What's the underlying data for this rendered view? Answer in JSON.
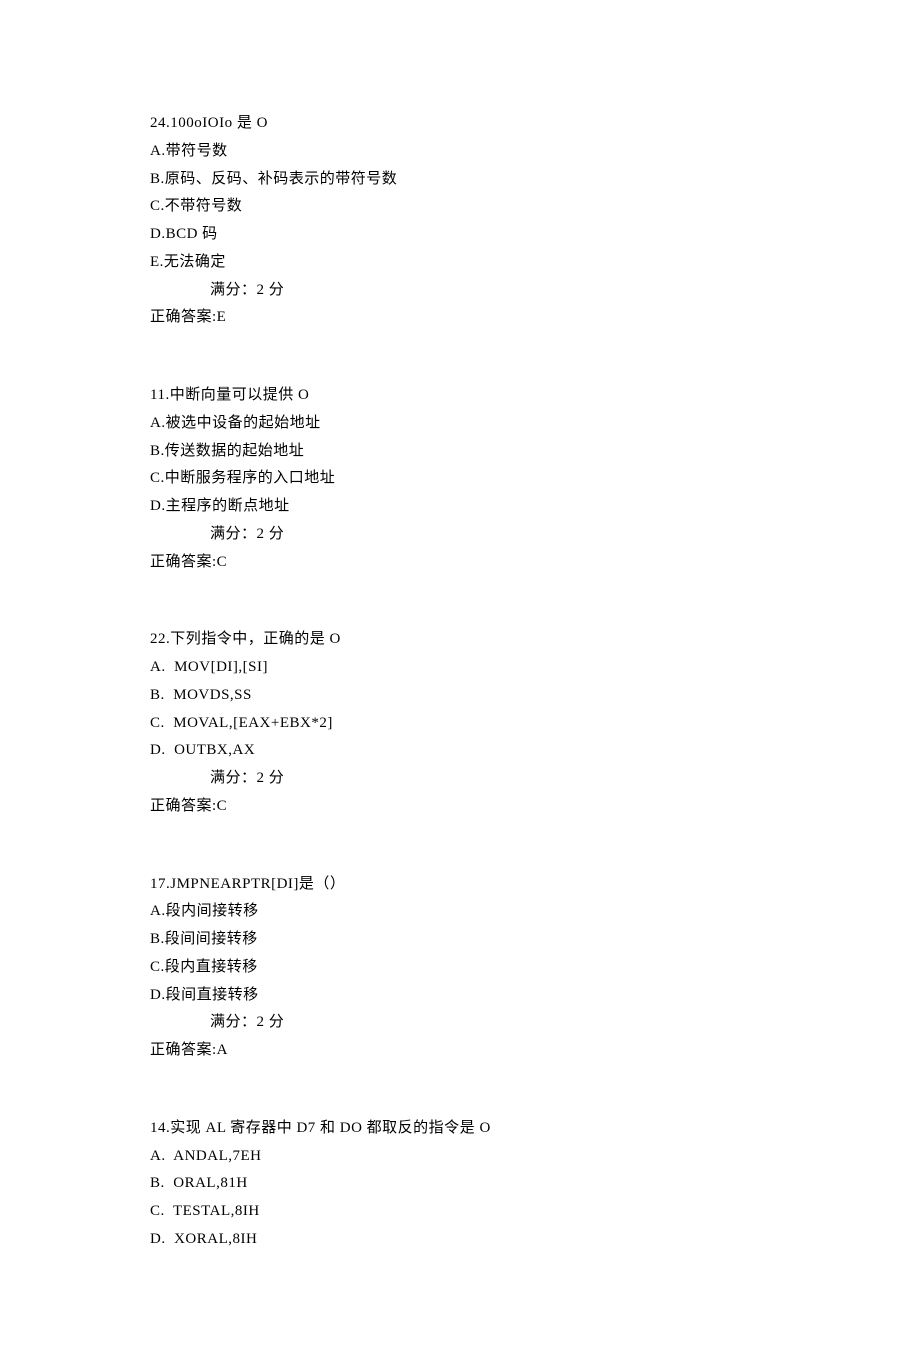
{
  "questions": [
    {
      "stem": "24.100oIOIo 是 O",
      "options": [
        "A.带符号数",
        "B.原码、反码、补码表示的带符号数",
        "C.不带符号数",
        "D.BCD 码",
        "E.无法确定"
      ],
      "score": "满分：2 分",
      "answer": "正确答案:E"
    },
    {
      "stem": "11.中断向量可以提供 O",
      "options": [
        "A.被选中设备的起始地址",
        "B.传送数据的起始地址",
        "C.中断服务程序的入口地址",
        "D.主程序的断点地址"
      ],
      "score": "满分：2 分",
      "answer": "正确答案:C"
    },
    {
      "stem": "22.下列指令中，正确的是 O",
      "options": [
        "A.  MOV[DI],[SI]",
        "B.  MOVDS,SS",
        "C.  MOVAL,[EAX+EBX*2]",
        "D.  OUTBX,AX"
      ],
      "score": "满分：2 分",
      "answer": "正确答案:C"
    },
    {
      "stem": "17.JMPNEARPTR[DI]是（）",
      "options": [
        "A.段内间接转移",
        "B.段间间接转移",
        "C.段内直接转移",
        "D.段间直接转移"
      ],
      "score": "满分：2 分",
      "answer": "正确答案:A"
    },
    {
      "stem": "14.实现 AL 寄存器中 D7 和 DO 都取反的指令是 O",
      "options": [
        "A.  ANDAL,7EH",
        "B.  ORAL,81H",
        "C.  TESTAL,8IH",
        "D.  XORAL,8IH"
      ],
      "score": "",
      "answer": ""
    }
  ]
}
